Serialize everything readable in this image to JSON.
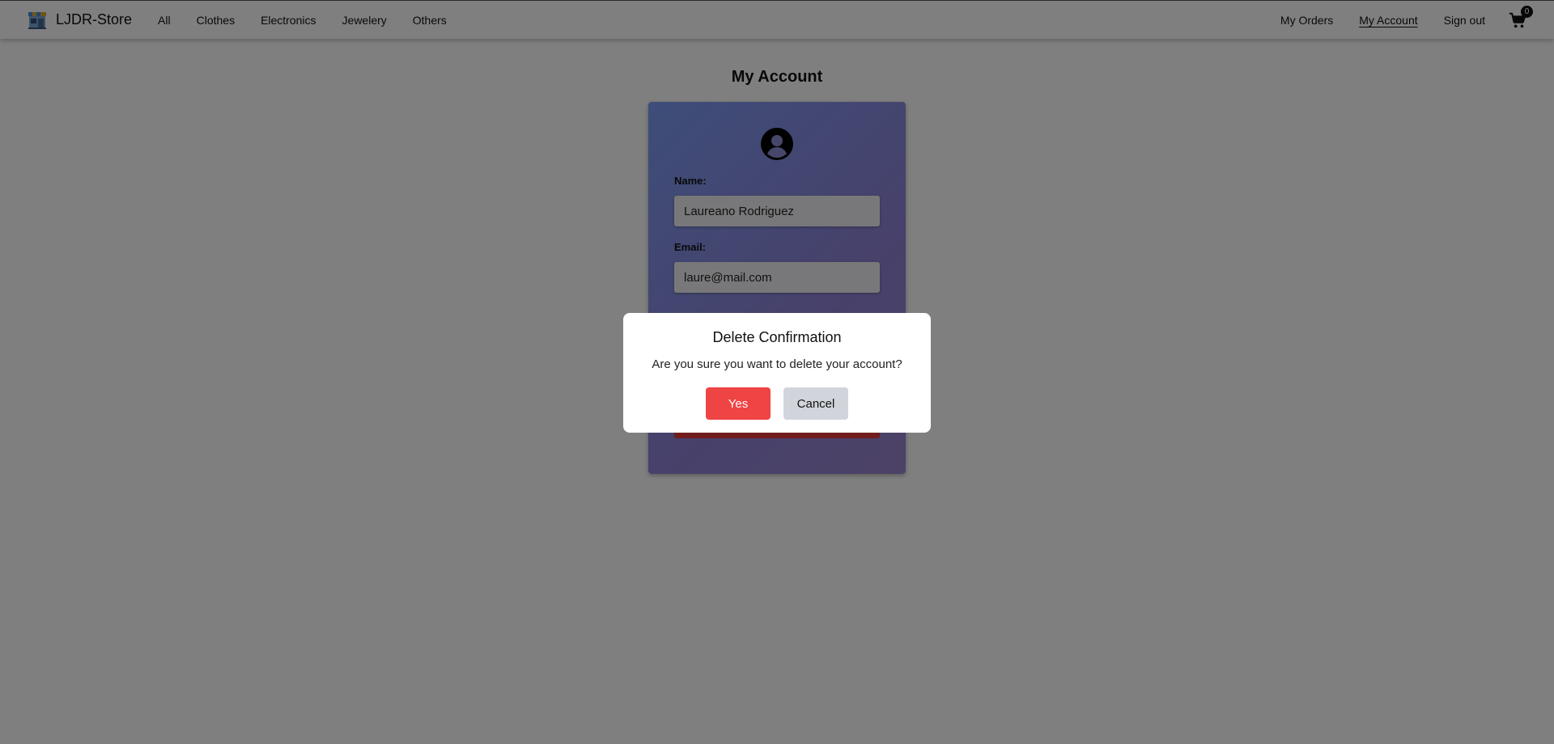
{
  "brand": {
    "name": "LJDR-Store",
    "logo_icon": "store-icon"
  },
  "nav": {
    "left": [
      "All",
      "Clothes",
      "Electronics",
      "Jewelery",
      "Others"
    ],
    "right": [
      "My Orders",
      "My Account",
      "Sign out"
    ],
    "active": "My Account",
    "cart_count": "0"
  },
  "page": {
    "title": "My Account"
  },
  "account": {
    "name_label": "Name:",
    "name_value": "Laureano Rodriguez",
    "email_label": "Email:",
    "email_value": "laure@mail.com"
  },
  "modal": {
    "title": "Delete Confirmation",
    "message": "Are you sure you want to delete your account?",
    "yes_label": "Yes",
    "cancel_label": "Cancel"
  },
  "colors": {
    "danger": "#ef4444",
    "cancel": "#d1d5db",
    "card_gradient_start": "#7c9bf3",
    "card_gradient_end": "#9a84cf"
  }
}
